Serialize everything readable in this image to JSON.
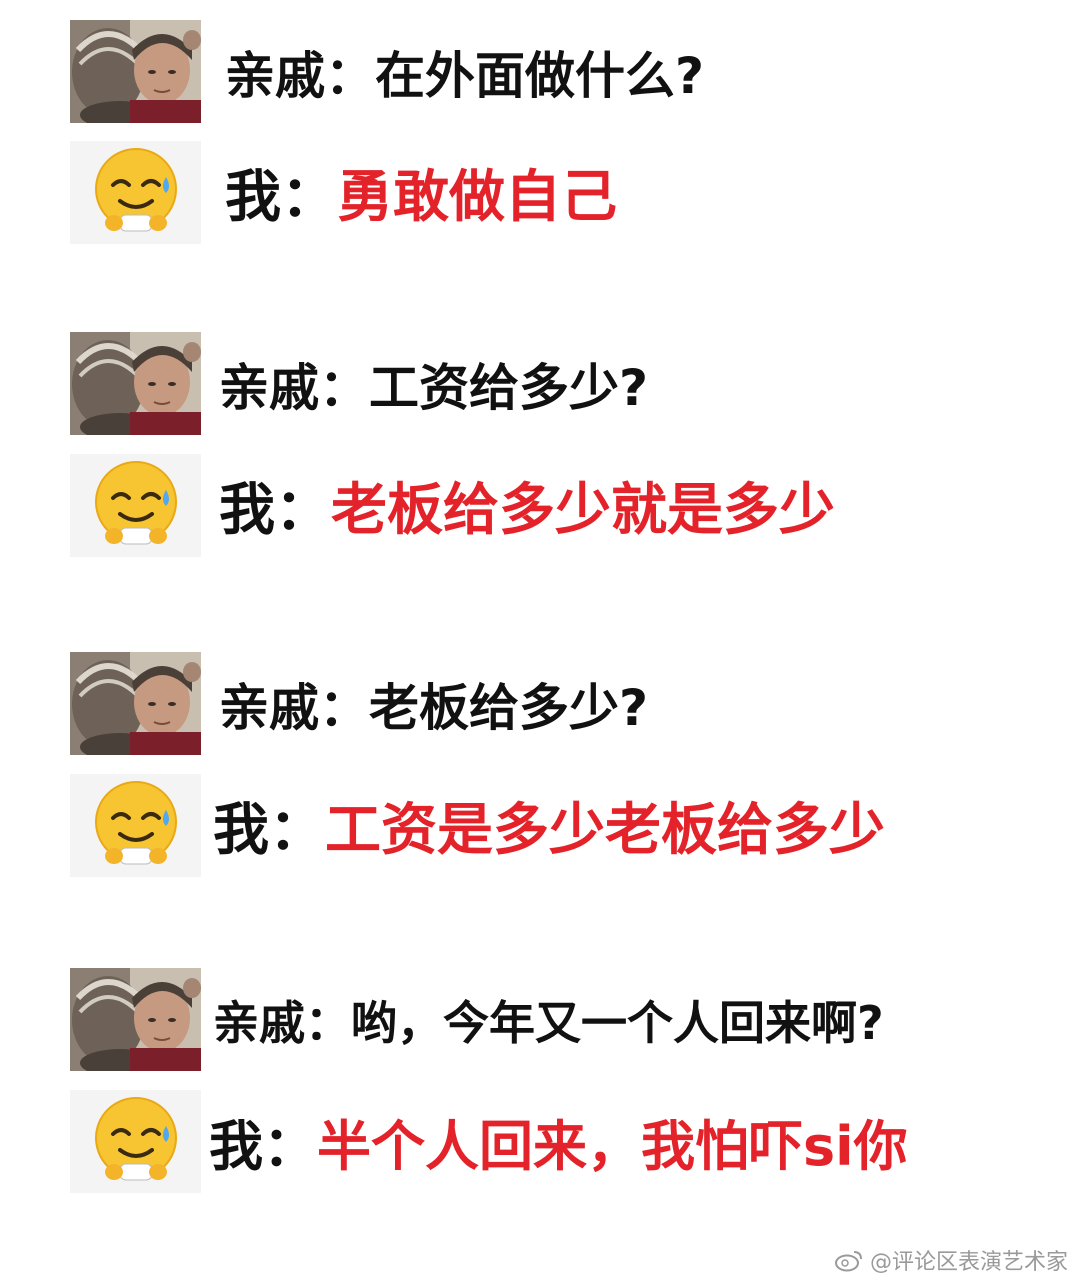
{
  "blocks": [
    {
      "relative": {
        "speaker": "亲戚：",
        "text": "在外面做什么?"
      },
      "me": {
        "speaker": "我：",
        "text": "勇敢做自己"
      }
    },
    {
      "relative": {
        "speaker": "亲戚：",
        "text": "工资给多少?"
      },
      "me": {
        "speaker": "我：",
        "text": "老板给多少就是多少"
      }
    },
    {
      "relative": {
        "speaker": "亲戚：",
        "text": "老板给多少?"
      },
      "me": {
        "speaker": "我：",
        "text": "工资是多少老板给多少"
      }
    },
    {
      "relative": {
        "speaker": "亲戚：",
        "text": "哟，今年又一个人回来啊?"
      },
      "me": {
        "speaker": "我：",
        "text": "半个人回来，我怕吓si你"
      }
    }
  ],
  "icons": {
    "relative_avatar": "relatives-photo-avatar",
    "me_avatar": "sweat-smile-emoji-icon"
  },
  "colors": {
    "answer": "#e3222a",
    "question": "#111111"
  },
  "watermark": {
    "text": "@评论区表演艺术家"
  }
}
